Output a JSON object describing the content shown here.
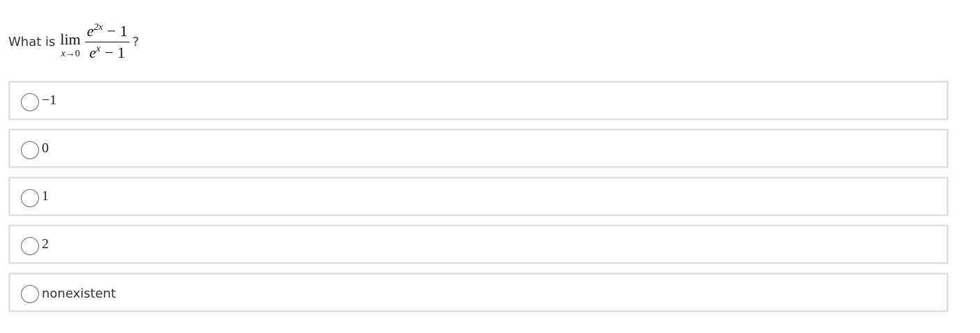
{
  "question": {
    "prefix": "What is",
    "lim_word": "lim",
    "lim_var": "x",
    "lim_arrow": "→",
    "lim_target": "0",
    "numerator": {
      "base": "e",
      "exponent": "2x",
      "operator": "−",
      "constant": "1"
    },
    "denominator": {
      "base": "e",
      "exponent": "x",
      "operator": "−",
      "constant": "1"
    },
    "suffix": "?"
  },
  "options": [
    {
      "label": "−1",
      "selected": false
    },
    {
      "label": "0",
      "selected": false
    },
    {
      "label": "1",
      "selected": false
    },
    {
      "label": "2",
      "selected": false
    },
    {
      "label": "nonexistent",
      "selected": false
    }
  ]
}
